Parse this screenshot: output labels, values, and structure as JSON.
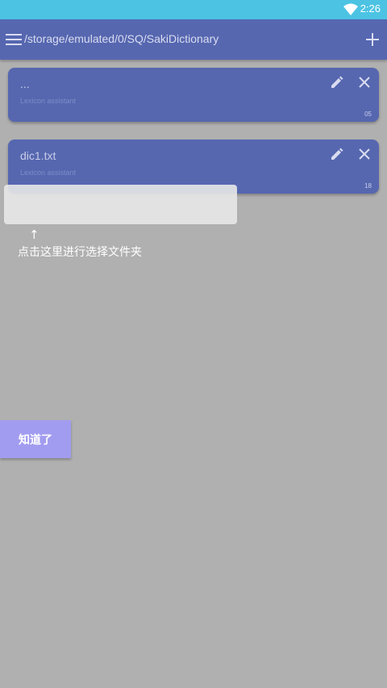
{
  "status_bar": {
    "time": "2:26",
    "wifi_icon": "wifi-icon"
  },
  "app_bar": {
    "menu_icon": "hamburger-menu-icon",
    "path": "/storage/emulated/0/SQ/SakiDictionary",
    "add_icon": "plus-icon"
  },
  "cards": [
    {
      "title": "...",
      "subtitle": "Lexicon assistant",
      "count": "05"
    },
    {
      "title": "dic1.txt",
      "subtitle": "Lexicon assistant",
      "count": "18"
    }
  ],
  "guide": {
    "arrow": "↑",
    "hint": "点击这里进行选择文件夹",
    "button_label": "知道了"
  },
  "colors": {
    "status_bar": "#4cc3e3",
    "app_bar": "#5667b0",
    "card": "#5667b0",
    "overlay_bg": "#b0b0b0",
    "button": "#a29cf0"
  }
}
